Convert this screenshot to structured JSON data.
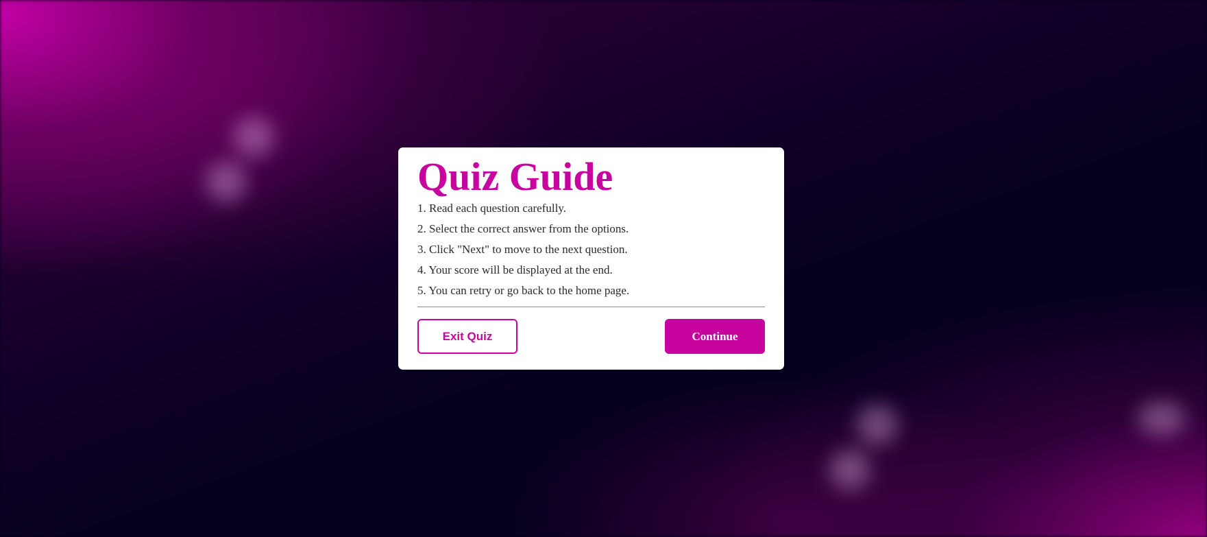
{
  "modal": {
    "title": "Quiz Guide",
    "rules": [
      "1. Read each question carefully.",
      "2. Select the correct answer from the options.",
      "3. Click \"Next\" to move to the next question.",
      "4. Your score will be displayed at the end.",
      "5. You can retry or go back to the home page."
    ],
    "exit_label": "Exit Quiz",
    "continue_label": "Continue"
  },
  "colors": {
    "accent": "#c7049d",
    "background_dark": "#05001c",
    "modal_bg": "#ffffff"
  }
}
